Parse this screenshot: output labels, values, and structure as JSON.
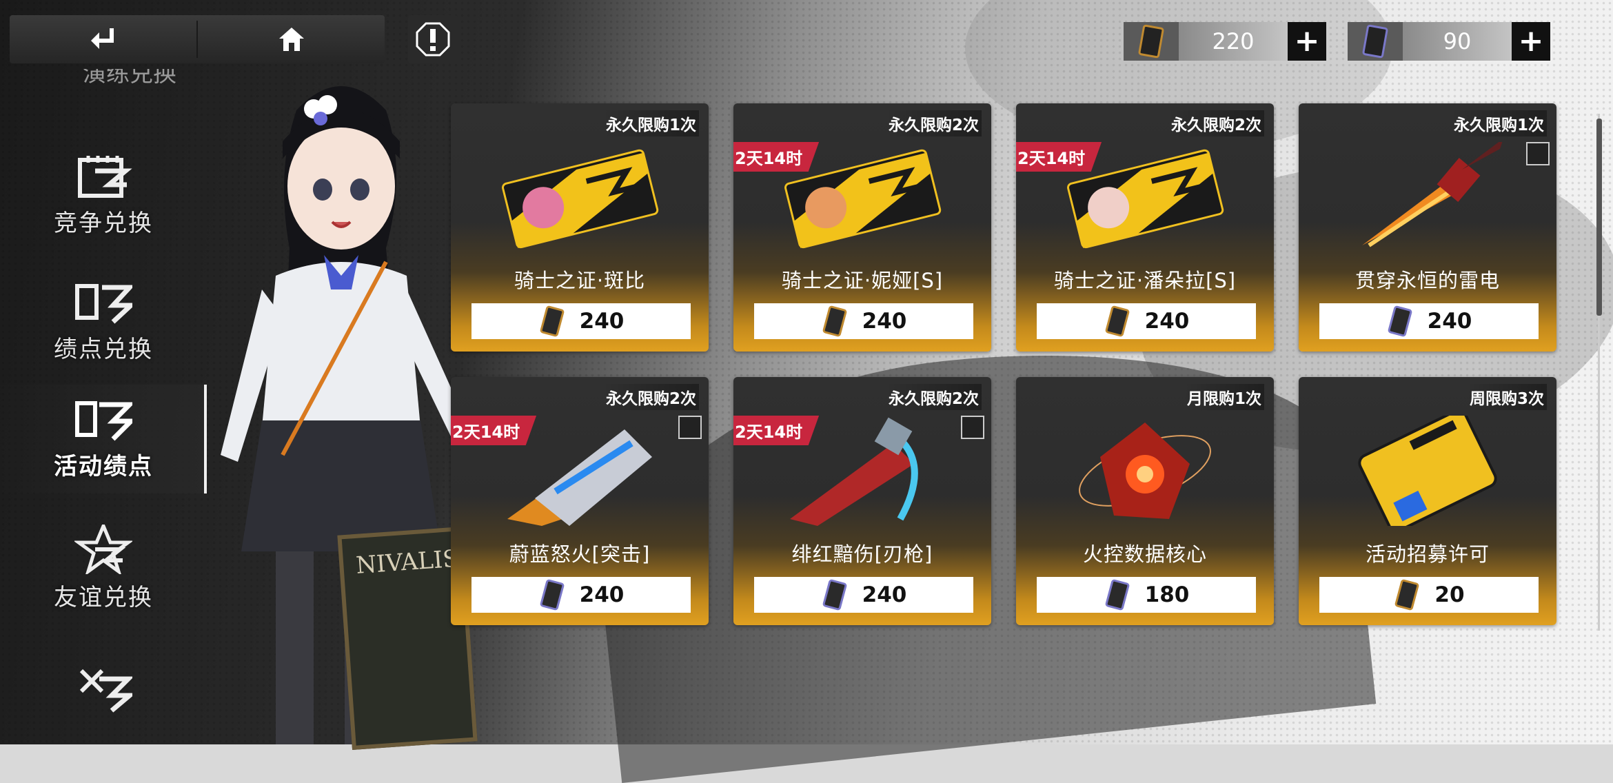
{
  "top_bar": {
    "back_icon": "return-arrow-icon",
    "home_icon": "home-icon",
    "alert_icon": "exclamation-icon"
  },
  "currencies": [
    {
      "icon": "badge-gold-icon",
      "value": "220",
      "plus": "+"
    },
    {
      "icon": "badge-purple-icon",
      "value": "90",
      "plus": "+"
    }
  ],
  "sidebar": {
    "partial_top_label": "演练兑换",
    "items": [
      {
        "label": "竞争兑换",
        "icon": "contest-icon"
      },
      {
        "label": "绩点兑换",
        "icon": "points-icon"
      },
      {
        "label": "活动绩点",
        "icon": "event-points-icon",
        "active": true
      },
      {
        "label": "友谊兑换",
        "icon": "friendship-icon"
      },
      {
        "label": "",
        "icon": "arrows-icon"
      }
    ]
  },
  "scene": {
    "sign_text": "NIVALIS"
  },
  "shop": {
    "items": [
      {
        "limit": "永久限购1次",
        "timer": "",
        "name": "骑士之证·斑比",
        "price": "240",
        "currency": "gold"
      },
      {
        "limit": "永久限购2次",
        "timer": "2天14时",
        "name": "骑士之证·妮娅[S]",
        "price": "240",
        "currency": "gold"
      },
      {
        "limit": "永久限购2次",
        "timer": "2天14时",
        "name": "骑士之证·潘朵拉[S]",
        "price": "240",
        "currency": "gold"
      },
      {
        "limit": "永久限购1次",
        "timer": "",
        "name": "贯穿永恒的雷电",
        "price": "240",
        "currency": "purple"
      },
      {
        "limit": "永久限购2次",
        "timer": "2天14时",
        "name": "蔚蓝怒火[突击]",
        "price": "240",
        "currency": "purple"
      },
      {
        "limit": "永久限购2次",
        "timer": "2天14时",
        "name": "绯红黯伤[刃枪]",
        "price": "240",
        "currency": "purple"
      },
      {
        "limit": "月限购1次",
        "timer": "",
        "name": "火控数据核心",
        "price": "180",
        "currency": "purple"
      },
      {
        "limit": "周限购3次",
        "timer": "",
        "name": "活动招募许可",
        "price": "20",
        "currency": "gold"
      }
    ]
  },
  "colors": {
    "timer_red": "#c8263e",
    "card_gold": "#e0a020",
    "card_dark": "#2d2d2d"
  }
}
